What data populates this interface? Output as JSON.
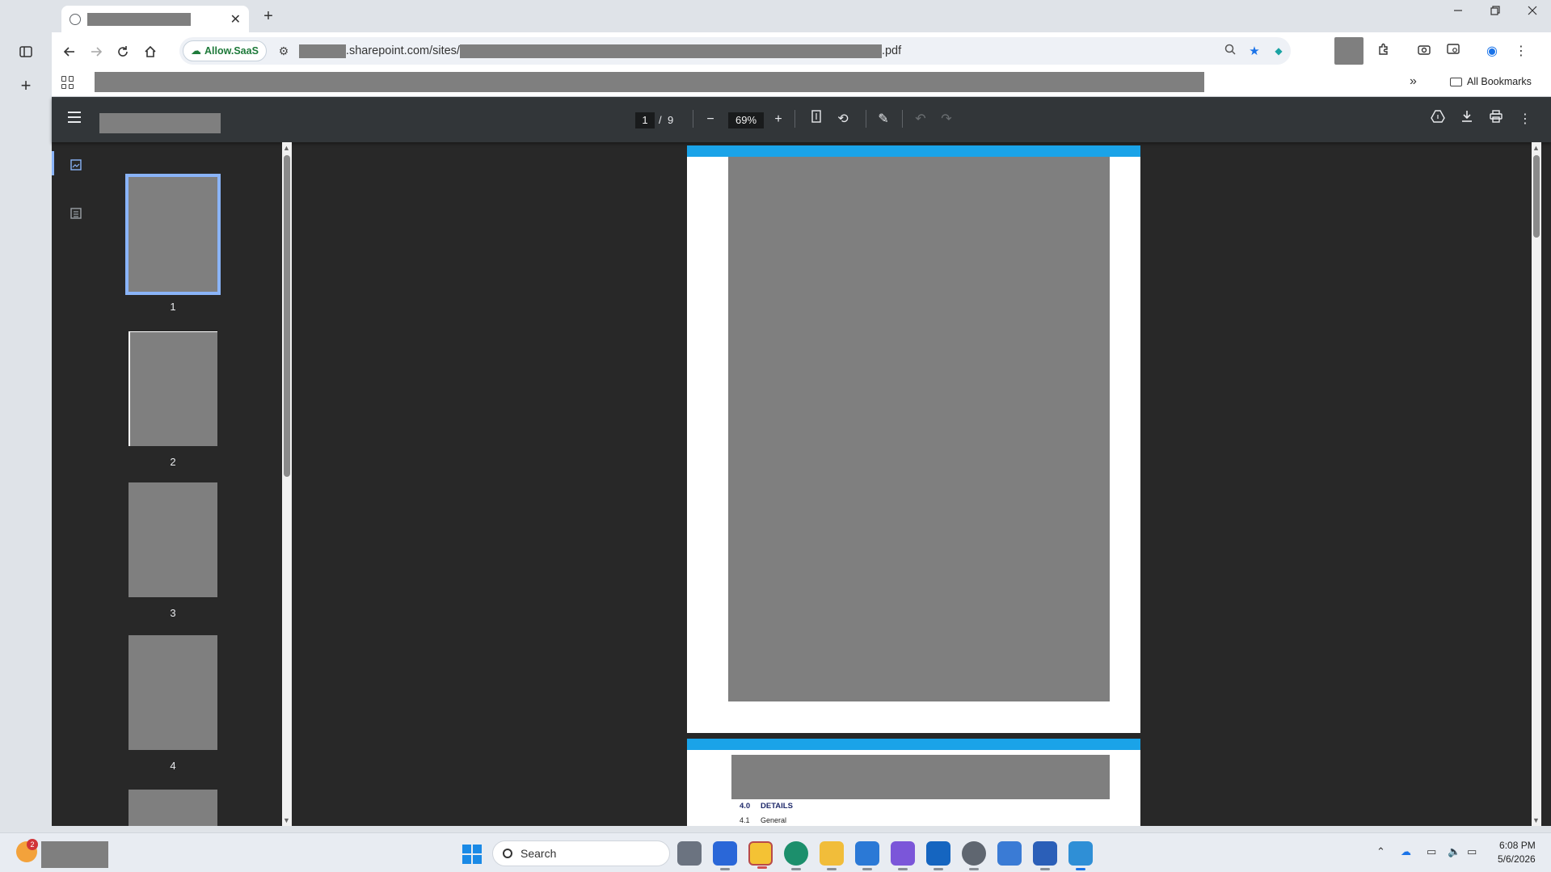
{
  "browser": {
    "url_domain_suffix": ".sharepoint.com/sites/",
    "url_extension": ".pdf",
    "security_chip": "Allow.SaaS",
    "bookmarks_all": "All Bookmarks",
    "tab_close": "✕",
    "new_tab": "+"
  },
  "pdf": {
    "current_page": "1",
    "page_separator": "/",
    "total_pages": "9",
    "zoom": "69%",
    "thumbnails": [
      "1",
      "2",
      "3",
      "4"
    ],
    "page2": {
      "section_num": "4.0",
      "section_title": "DETAILS",
      "sub_num": "4.1",
      "sub_title": "General"
    }
  },
  "taskbar": {
    "search_label": "Search",
    "time": "6:08 PM",
    "date": "5/6/2026",
    "weather_badge": "2"
  },
  "colors": {
    "accent_blue": "#1aa3e8",
    "selection": "#8ab4f8",
    "viewer_bg": "#282828",
    "toolbar_bg": "#323639"
  }
}
